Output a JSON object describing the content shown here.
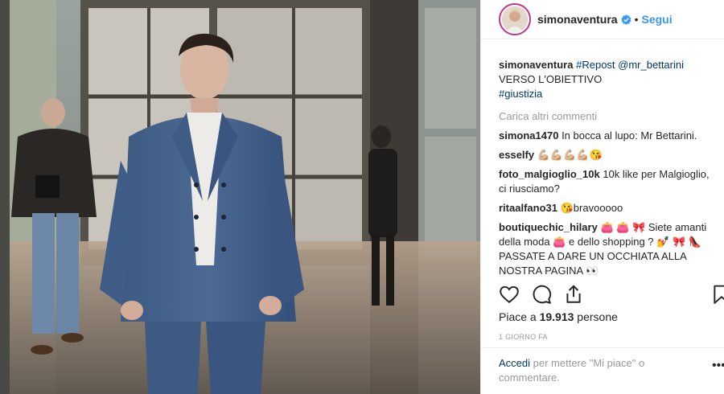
{
  "header": {
    "username": "simonaventura",
    "dot": "•",
    "follow_label": "Segui"
  },
  "caption": {
    "username": "simonaventura",
    "parts": [
      "#Repost",
      "@mr_bettarini"
    ],
    "line2": "VERSO L'OBIETTIVO",
    "hashtag": "#giustizia"
  },
  "load_more": "Carica altri commenti",
  "comments": [
    {
      "user": "simona1470",
      "text": "In bocca al lupo: Mr Bettarini."
    },
    {
      "user": "esselfy",
      "text": "💪🏼💪🏼💪🏼💪🏼😘"
    },
    {
      "user": "foto_malgioglio_10k",
      "text": "10k like per Malgioglio, ci riusciamo?"
    },
    {
      "user": "ritaalfano31",
      "text": "😘bravooooo"
    },
    {
      "user": "boutiquechic_hilary",
      "text": "👛 👛 🎀 Siete amanti della moda 👛 e dello shopping ? 💅 🎀 👠 PASSATE A DARE UN OCCHIATA ALLA NOSTRA PAGINA 👀"
    }
  ],
  "actions": {
    "like": "heart-icon",
    "comment": "comment-icon",
    "share": "share-icon",
    "save": "bookmark-icon"
  },
  "likes": {
    "prefix": "Piace a ",
    "count": "19.913",
    "suffix": " persone"
  },
  "time": "1 GIORNO FA",
  "login": {
    "link": "Accedi",
    "text": " per mettere \"Mi piace\" o commentare."
  },
  "more_label": "•••",
  "colors": {
    "follow": "#3897f0",
    "hashtag": "#003569",
    "muted": "#999999",
    "avatar_ring": "#c13584"
  }
}
